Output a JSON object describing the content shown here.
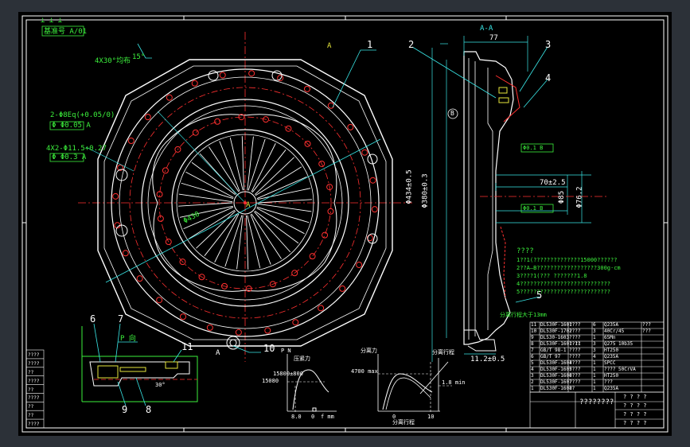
{
  "header": {
    "marks": "⊥ ⊥ ⊥",
    "ref_box": "基准号 A/01"
  },
  "balloons": {
    "one": "1",
    "two": "2",
    "three": "3",
    "four": "4",
    "five": "5",
    "six": "6",
    "seven": "7",
    "eight": "8",
    "nine": "9",
    "ten": "10",
    "eleven": "11"
  },
  "front_view": {
    "hole_callout": "4X30°均布",
    "dim_15": "15°",
    "tol_a": "2-Φ8Eq(+0.05/0)",
    "tol_a_frame": "Φ Φ0.05 A",
    "tol_b": "4X2-Φ11.5+0.27",
    "tol_b_frame": "Φ Φ0.3 A",
    "center_label": "A",
    "diag_dim": "Φ430",
    "section_mark_top": "A",
    "section_mark_bottom": "A"
  },
  "section_view": {
    "title": "A-A",
    "dim_77": "77",
    "datum_b": "B",
    "dim_434": "Φ434±0.5",
    "dim_380": "Φ380±0.3",
    "dim_70": "70±2.5",
    "dim_d85": "Φ85",
    "dim_d76": "Φ76.2",
    "dim_ref": "Φ0.1 B",
    "dim_spline": "Φ0.1 B",
    "dim_112": "11.2±0.5",
    "stroke_note": "分离行程大于13mm"
  },
  "tech_notes": {
    "title": "????",
    "lines": [
      "1??1(??????????????15000??????",
      "2??A—B??????????????????300g·cm",
      "3????1(??? ???????1.8",
      "4???????????????????????????",
      "5???????????????????????????"
    ]
  },
  "detail": {
    "label": "P 向",
    "angle": "30°"
  },
  "charts": {
    "chart1_ylabel": "P N",
    "chart1_label_a": "15800±800",
    "chart1_label_b": "15080",
    "chart1_x": "8.0",
    "chart1_x2": "0",
    "chart1_unit": "f mm",
    "chart1_side": "压紧力",
    "chart2_ylabel": "分离力",
    "chart2_label": "4700 max",
    "chart2_x": "0",
    "chart2_x2": "10",
    "chart2_side": "分离行程",
    "chart3_ylabel": "分离行程",
    "chart3_label": "1.8 min"
  },
  "parts_table": {
    "rows": [
      [
        "11",
        "DL530F-1601",
        "????",
        "6",
        "Q235A",
        "???"
      ],
      [
        "10",
        "DL530F-1702",
        "????",
        "3",
        "40Cr/45",
        "???"
      ],
      [
        "9",
        "DL530-1603",
        "????",
        "1",
        "65Mn",
        ""
      ],
      [
        "8",
        "DL530F-1601-11",
        "????",
        "3",
        "Q275 10b35",
        ""
      ],
      [
        "7",
        "GB/T 98-1",
        "????",
        "3",
        "HT250",
        ""
      ],
      [
        "6",
        "GB/T 97",
        "????",
        "4",
        "Q235A",
        ""
      ],
      [
        "5",
        "DL530F-1604",
        "????",
        "1",
        "SPCC",
        ""
      ],
      [
        "4",
        "DL530F-1605",
        "????",
        "1",
        "???? 50CrVA",
        ""
      ],
      [
        "3",
        "DL530F-1606",
        "????",
        "1",
        "HT250",
        ""
      ],
      [
        "2",
        "DL530F-1607",
        "????",
        "1",
        "???",
        ""
      ],
      [
        "1",
        "DL530F-1608",
        "??",
        "1",
        "Q235A",
        ""
      ]
    ],
    "title_block": "????????",
    "tb_cells": [
      "? ? ? ?",
      "? ? ? ?",
      "? ? ? ?",
      "? ? ? ?"
    ]
  },
  "left_strip": {
    "labels": [
      "????",
      "????",
      "??",
      "????",
      "??",
      "????",
      "??",
      "??",
      "????"
    ]
  }
}
